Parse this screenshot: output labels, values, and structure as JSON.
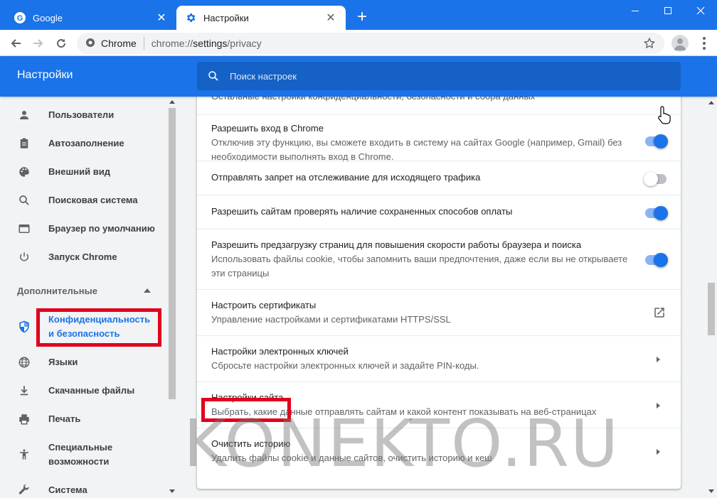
{
  "tabs": [
    {
      "title": "Google",
      "active": false
    },
    {
      "title": "Настройки",
      "active": true
    }
  ],
  "omnibox": {
    "site_chip": "Chrome",
    "url_scheme": "chrome://",
    "url_host": "settings",
    "url_path": "/privacy"
  },
  "header": {
    "title": "Настройки",
    "search_placeholder": "Поиск настроек"
  },
  "sidebar": {
    "items": [
      {
        "label": "Пользователи",
        "icon": "person-icon"
      },
      {
        "label": "Автозаполнение",
        "icon": "clipboard-icon"
      },
      {
        "label": "Внешний вид",
        "icon": "palette-icon"
      },
      {
        "label": "Поисковая система",
        "icon": "search-icon"
      },
      {
        "label": "Браузер по умолчанию",
        "icon": "browser-icon"
      },
      {
        "label": "Запуск Chrome",
        "icon": "power-icon"
      }
    ],
    "advanced_title": "Дополнительные",
    "advanced_items": [
      {
        "label": "Конфиденциальность и безопасность",
        "icon": "shield-icon",
        "active": true
      },
      {
        "label": "Языки",
        "icon": "globe-icon"
      },
      {
        "label": "Скачанные файлы",
        "icon": "download-icon"
      },
      {
        "label": "Печать",
        "icon": "printer-icon"
      },
      {
        "label": "Специальные возможности",
        "icon": "accessibility-icon"
      },
      {
        "label": "Система",
        "icon": "wrench-icon"
      }
    ]
  },
  "main": {
    "rows": [
      {
        "title": "",
        "subtitle": "Остальные настройки конфиденциальности, безопасности и сбора данных",
        "control": "none"
      },
      {
        "title": "Разрешить вход в Chrome",
        "subtitle": "Отключив эту функцию, вы сможете входить в систему на сайтах Google (например, Gmail) без необходимости выполнять вход в Chrome.",
        "control": "toggle",
        "on": true
      },
      {
        "title": "Отправлять запрет на отслеживание для исходящего трафика",
        "subtitle": "",
        "control": "toggle",
        "on": false
      },
      {
        "title": "Разрешить сайтам проверять наличие сохраненных способов оплаты",
        "subtitle": "",
        "control": "toggle",
        "on": true
      },
      {
        "title": "Разрешить предзагрузку страниц для повышения скорости работы браузера и поиска",
        "subtitle": "Использовать файлы cookie, чтобы запомнить ваши предпочтения, даже если вы не открываете эти страницы",
        "control": "toggle",
        "on": true
      },
      {
        "title": "Настроить сертификаты",
        "subtitle": "Управление настройками и сертификатами HTTPS/SSL",
        "control": "external"
      },
      {
        "title": "Настройки электронных ключей",
        "subtitle": "Сбросьте настройки электронных ключей и задайте PIN-коды.",
        "control": "chevron"
      },
      {
        "title": "Настройки сайта",
        "subtitle": "Выбрать, какие данные отправлять сайтам и какой контент показывать на веб-страницах",
        "control": "chevron"
      },
      {
        "title": "Очистить историю",
        "subtitle": "Удалить файлы cookie и данные сайтов, очистить историю и кеш",
        "control": "chevron"
      }
    ]
  },
  "watermark": "KONEKTO.RU",
  "colors": {
    "accent": "#1a73e8",
    "highlight": "#e0001b"
  }
}
